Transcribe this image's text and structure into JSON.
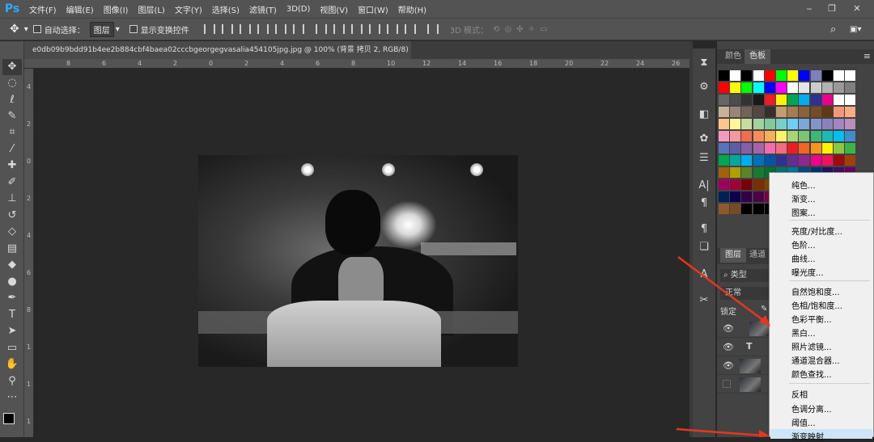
{
  "app": {
    "logo": "Ps"
  },
  "menu": [
    "文件(F)",
    "编辑(E)",
    "图像(I)",
    "图层(L)",
    "文字(Y)",
    "选择(S)",
    "滤镜(T)",
    "3D(D)",
    "视图(V)",
    "窗口(W)",
    "帮助(H)"
  ],
  "options": {
    "auto_select": "自动选择：",
    "auto_select_value": "图层",
    "show_transform": "显示变换控件",
    "mode_3d": "3D 模式："
  },
  "document": {
    "tab_title": "e0db09b9bdd91b4ee2b884cbf4baea02cccbgeorgegvasalia454105jpg.jpg @ 100% (背景 拷贝 2, RGB/8) *",
    "close": "×"
  },
  "ruler_h": [
    "8",
    "6",
    "4",
    "2",
    "0",
    "2",
    "4",
    "6",
    "8",
    "10",
    "12",
    "14",
    "16",
    "18",
    "20",
    "22",
    "24",
    "26",
    "28"
  ],
  "ruler_v": [
    "4",
    "2",
    "0",
    "2",
    "4",
    "6",
    "8",
    "1",
    "1",
    "1"
  ],
  "panels": {
    "color_tab": "颜色",
    "swatches_tab": "色板",
    "layers_tab": "图层",
    "channels_tab": "通道",
    "kind": "类型",
    "blend_mode": "正常",
    "lock": "锁定"
  },
  "swatch_colors": [
    [
      "#000000",
      "#ffffff",
      "#000000",
      "#ffffff",
      "#ff0000",
      "#00ff00",
      "#ffff00",
      "#0000ff",
      "#7f7fbf",
      "#000000",
      "#ffffff",
      "#ffffff"
    ],
    [
      "#ff0000",
      "#ffff00",
      "#00ff00",
      "#00ffff",
      "#0000ff",
      "#ff00ff",
      "#ffffff",
      "#e5e5e5",
      "#cccccc",
      "#b2b2b2",
      "#999999",
      "#7f7f7f"
    ],
    [
      "#666666",
      "#4c4c4c",
      "#333333",
      "#191919",
      "#ed1c24",
      "#fff200",
      "#00a651",
      "#00aeef",
      "#2e3192",
      "#ec008c",
      "#ffffff",
      "#ffffff"
    ],
    [
      "#c7b299",
      "#998675",
      "#736357",
      "#534741",
      "#362f2d",
      "#c69c6d",
      "#a67c52",
      "#8c6239",
      "#754c24",
      "#603813",
      "#f7977a",
      "#f9ad81"
    ],
    [
      "#fdc68a",
      "#fff79a",
      "#c4df9b",
      "#a3d39c",
      "#82ca9d",
      "#7bcdc8",
      "#6ecff6",
      "#7ea7d8",
      "#8493ca",
      "#8882be",
      "#a187be",
      "#bc8dbf"
    ],
    [
      "#f49ac2",
      "#f6989d",
      "#f26c4f",
      "#f68e56",
      "#fbaf5d",
      "#fff467",
      "#acd373",
      "#7cc576",
      "#3bb878",
      "#1abbb4",
      "#00bff3",
      "#438cca"
    ],
    [
      "#5574b9",
      "#605ca8",
      "#855fa8",
      "#a864a8",
      "#f06ea9",
      "#f26d7d",
      "#ed1c24",
      "#f26522",
      "#f7941d",
      "#fff200",
      "#8dc73f",
      "#39b54a"
    ],
    [
      "#00a651",
      "#00a99d",
      "#00aeef",
      "#0072bc",
      "#0054a6",
      "#2e3192",
      "#662d91",
      "#92278f",
      "#ec008c",
      "#ed145b",
      "#9e0b0f",
      "#a0410d"
    ],
    [
      "#a36209",
      "#aba000",
      "#598527",
      "#197b30",
      "#007236",
      "#00746b",
      "#0076a3",
      "#004a80",
      "#003471",
      "#1b1464",
      "#440e62",
      "#630460"
    ],
    [
      "#9e005d",
      "#9e0039",
      "#790000",
      "#7b2e00",
      "#7d4900",
      "#827b00",
      "#406618",
      "#005e20",
      "#005826",
      "#005952",
      "#005b7f",
      "#003663"
    ],
    [
      "#002157",
      "#0d004c",
      "#32004b",
      "#4b0049",
      "#7b0046",
      "#7a0026",
      "#8c6239",
      "#603813",
      "#c69c6d",
      "#998675",
      "#736357",
      "#534741"
    ],
    [
      "#8c5a2b",
      "#754c24",
      "#000000",
      "#000000",
      "#000000",
      "#000000",
      "#000000",
      "#000000",
      "#000000",
      "#000000",
      "#000000",
      "#000000"
    ]
  ],
  "context_menu": {
    "group1": [
      "纯色...",
      "渐变...",
      "图案..."
    ],
    "group2": [
      "亮度/对比度...",
      "色阶...",
      "曲线...",
      "曝光度..."
    ],
    "group3": [
      "自然饱和度...",
      "色相/饱和度...",
      "色彩平衡...",
      "黑白...",
      "照片滤镜...",
      "通道混合器...",
      "颜色查找..."
    ],
    "group4": [
      "反相",
      "色调分离...",
      "阈值...",
      "渐变映射..."
    ]
  },
  "layers": {
    "text_marker": "T"
  },
  "colors": {
    "accent": "#31a8ff",
    "arrow": "#e8351e"
  }
}
